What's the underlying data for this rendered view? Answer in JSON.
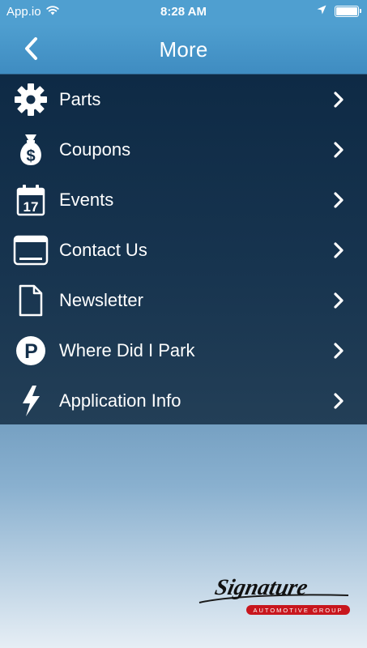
{
  "status_bar": {
    "carrier": "App.io",
    "time": "8:28 AM",
    "wifi_icon": "wifi-icon",
    "location_icon": "location-arrow-icon",
    "battery_level": 1.0
  },
  "nav": {
    "title": "More",
    "back_icon": "chevron-left-icon"
  },
  "menu": {
    "items": [
      {
        "label": "Parts",
        "icon": "gear-icon"
      },
      {
        "label": "Coupons",
        "icon": "money-bag-icon"
      },
      {
        "label": "Events",
        "icon": "calendar-icon",
        "icon_text": "17"
      },
      {
        "label": "Contact Us",
        "icon": "window-icon"
      },
      {
        "label": "Newsletter",
        "icon": "document-icon"
      },
      {
        "label": "Where Did I Park",
        "icon": "parking-icon",
        "icon_text": "P"
      },
      {
        "label": "Application Info",
        "icon": "lightning-icon"
      }
    ]
  },
  "logo": {
    "name": "Signature",
    "tagline": "AUTOMOTIVE GROUP",
    "accent_color": "#c8161d"
  },
  "colors": {
    "status_bar": "#4f9fd0",
    "nav_bar": "#3f8cc1",
    "menu_background": "#17344f",
    "text": "#ffffff"
  }
}
